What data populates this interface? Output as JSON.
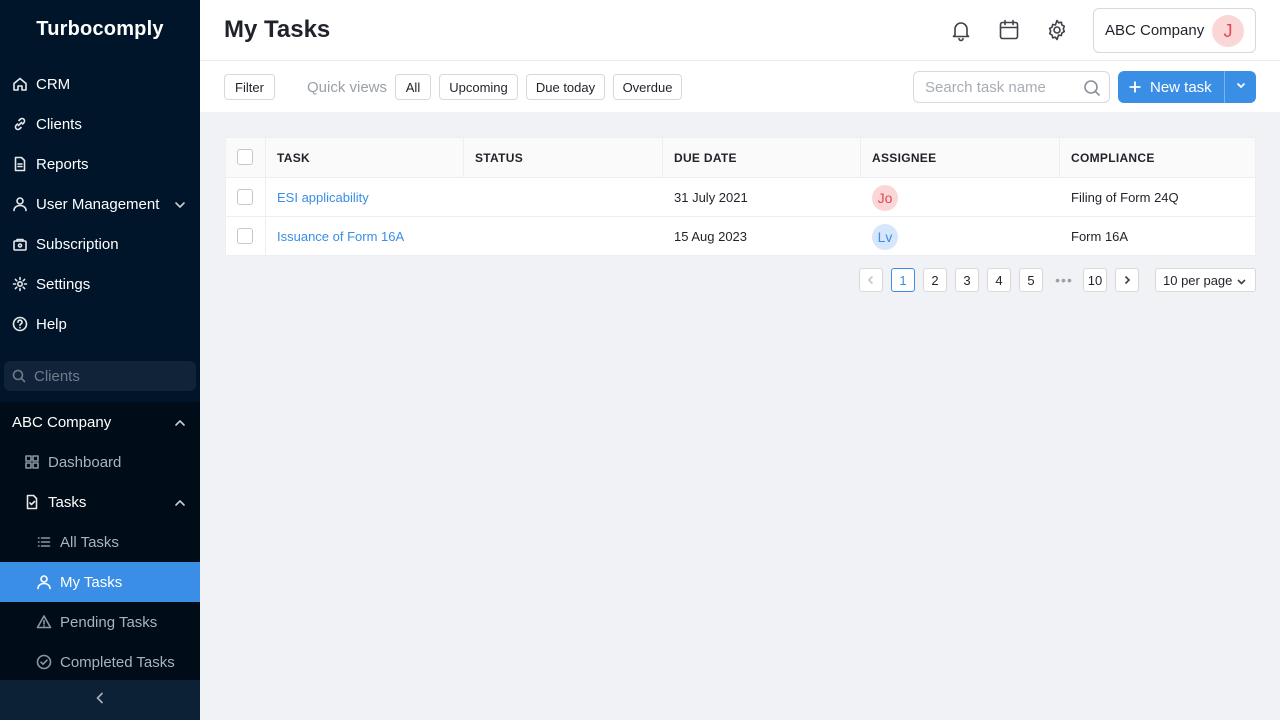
{
  "app": {
    "logo": "Turbocomply"
  },
  "sidebar": {
    "items": [
      {
        "label": "CRM",
        "icon": "home-icon"
      },
      {
        "label": "Clients",
        "icon": "link-icon"
      },
      {
        "label": "Reports",
        "icon": "report-icon"
      },
      {
        "label": "User Management",
        "icon": "user-icon"
      },
      {
        "label": "Subscription",
        "icon": "subscription-icon"
      },
      {
        "label": "Settings",
        "icon": "gear-icon"
      },
      {
        "label": "Help",
        "icon": "help-icon"
      }
    ],
    "search_placeholder": "Clients",
    "company": "ABC Company",
    "company_items": [
      {
        "label": "Dashboard",
        "icon": "dashboard-icon"
      },
      {
        "label": "Tasks",
        "icon": "tasks-icon"
      }
    ],
    "task_items": [
      {
        "label": "All Tasks",
        "icon": "list-icon"
      },
      {
        "label": "My Tasks",
        "icon": "user-icon"
      },
      {
        "label": "Pending Tasks",
        "icon": "warning-icon"
      },
      {
        "label": "Completed Tasks",
        "icon": "check-circle-icon"
      }
    ]
  },
  "header": {
    "title": "My Tasks",
    "company": "ABC Company",
    "avatar": "J"
  },
  "toolbar": {
    "filter": "Filter",
    "quick_views_label": "Quick views",
    "quick_views": [
      "All",
      "Upcoming",
      "Due today",
      "Overdue"
    ],
    "search_placeholder": "Search task name",
    "new_task": "New task"
  },
  "table": {
    "columns": [
      "TASK",
      "STATUS",
      "DUE DATE",
      "ASSIGNEE",
      "COMPLIANCE"
    ],
    "rows": [
      {
        "task": "ESI applicability",
        "status": "",
        "due_date": "31 July 2021",
        "assignee": "Jo",
        "compliance": "Filing of Form 24Q"
      },
      {
        "task": "Issuance of Form 16A",
        "status": "",
        "due_date": "15 Aug 2023",
        "assignee": "Lv",
        "compliance": "Form 16A"
      }
    ]
  },
  "pagination": {
    "pages": [
      "1",
      "2",
      "3",
      "4",
      "5"
    ],
    "dots": "•••",
    "last": "10",
    "current": "1",
    "per_page": "10 per page"
  },
  "colors": {
    "accent": "#3a8ee6",
    "sidebar_bg": "#001529"
  }
}
